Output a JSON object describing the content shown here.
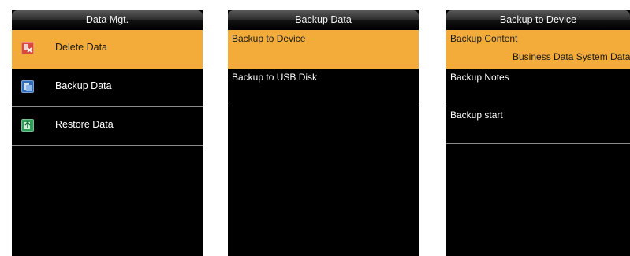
{
  "screens": [
    {
      "title": "Data Mgt.",
      "items": [
        {
          "label": "Delete Data",
          "icon": "delete-data-icon",
          "icon_color": "#d94a3d",
          "selected": true
        },
        {
          "label": "Backup Data",
          "icon": "backup-data-icon",
          "icon_color": "#2f6fc0",
          "selected": false
        },
        {
          "label": "Restore Data",
          "icon": "restore-data-icon",
          "icon_color": "#2e9e58",
          "selected": false
        }
      ]
    },
    {
      "title": "Backup Data",
      "items": [
        {
          "label": "Backup to Device",
          "selected": true
        },
        {
          "label": "Backup to USB Disk",
          "selected": false
        }
      ]
    },
    {
      "title": "Backup to Device",
      "items": [
        {
          "label": "Backup Content",
          "value": "Business Data System Data",
          "selected": true
        },
        {
          "label": "Backup Notes",
          "selected": false
        },
        {
          "label": "Backup start",
          "selected": false
        }
      ]
    }
  ],
  "colors": {
    "highlight": "#f3ac39",
    "screen_bg": "#000000",
    "divider": "#8a8a8a"
  }
}
